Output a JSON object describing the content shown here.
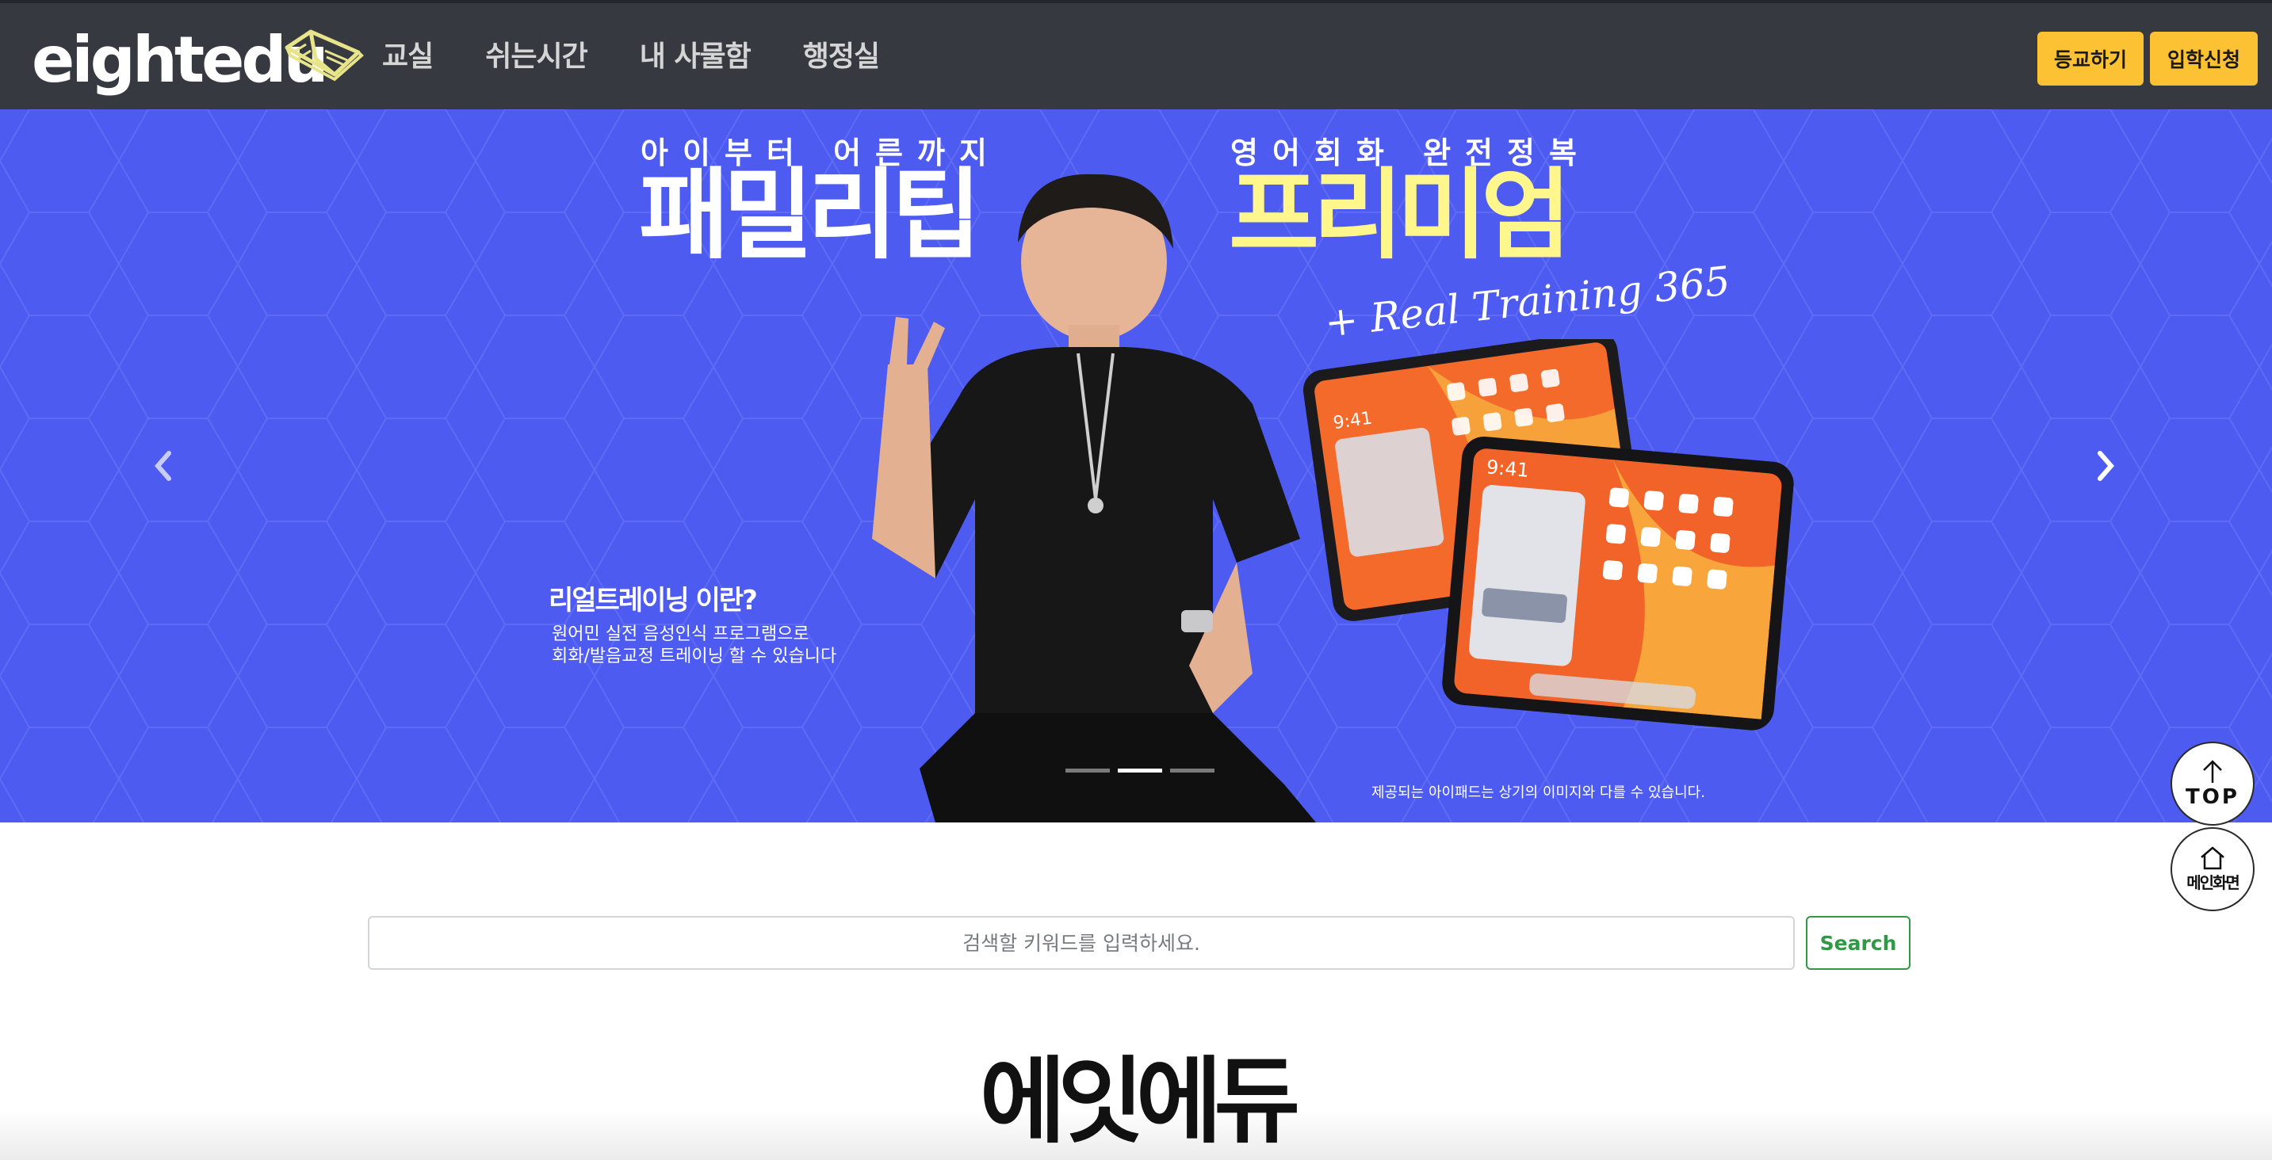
{
  "header": {
    "logo_text": "eightedu",
    "nav": [
      {
        "label": "교실"
      },
      {
        "label": "쉬는시간"
      },
      {
        "label": "내 사물함"
      },
      {
        "label": "행정실"
      }
    ],
    "register_label": "등교하기",
    "enroll_label": "입학신청"
  },
  "hero": {
    "left_small": "아이부터 어른까지",
    "left_big": "패밀리팁",
    "right_small": "영어회화 완전정복",
    "right_big": "프리미엄",
    "script_text": "+ Real Training 365",
    "rt_title": "리얼트레이닝 이란?",
    "rt_desc_1": "원어민 실전 음성인식 프로그램으로",
    "rt_desc_2": "회화/발음교정 트레이닝 할 수 있습니다",
    "disclaimer": "제공되는 아이패드는 상기의 이미지와 다를 수 있습니다.",
    "slide_count": 3,
    "active_slide": 2,
    "tablet_time": "9:41"
  },
  "floating": {
    "top_label": "TOP",
    "home_label": "메인화면"
  },
  "search": {
    "placeholder": "검색할 키워드를 입력하세요.",
    "button_label": "Search"
  },
  "brand_heading": "에잇에듀",
  "colors": {
    "header_bg": "#363a40",
    "hero_bg": "#4d5bf1",
    "accent_yellow": "#fcc233",
    "hero_highlight": "#fff78c",
    "search_green": "#2f9944"
  }
}
